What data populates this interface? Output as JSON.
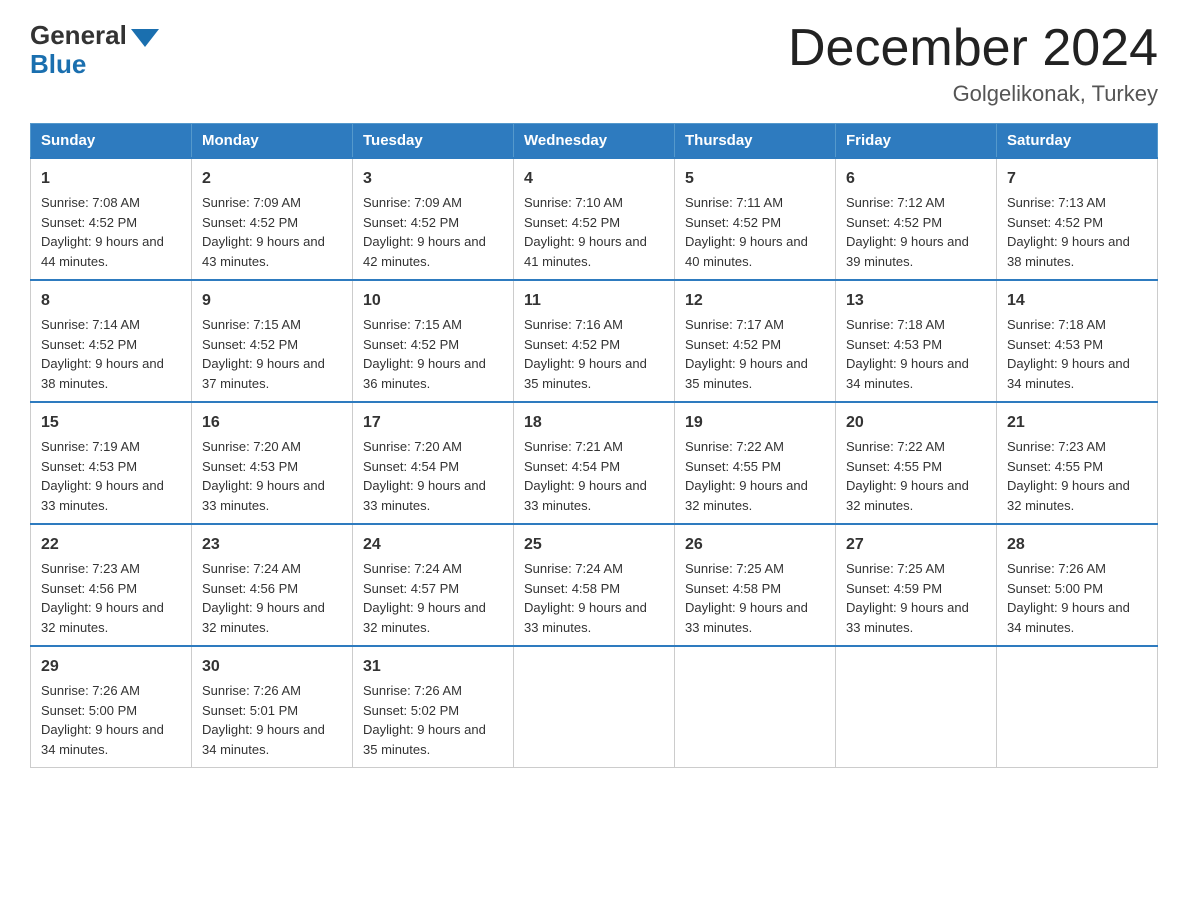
{
  "logo": {
    "general": "General",
    "blue": "Blue"
  },
  "title": "December 2024",
  "location": "Golgelikonak, Turkey",
  "weekdays": [
    "Sunday",
    "Monday",
    "Tuesday",
    "Wednesday",
    "Thursday",
    "Friday",
    "Saturday"
  ],
  "weeks": [
    [
      {
        "day": "1",
        "sunrise": "Sunrise: 7:08 AM",
        "sunset": "Sunset: 4:52 PM",
        "daylight": "Daylight: 9 hours and 44 minutes."
      },
      {
        "day": "2",
        "sunrise": "Sunrise: 7:09 AM",
        "sunset": "Sunset: 4:52 PM",
        "daylight": "Daylight: 9 hours and 43 minutes."
      },
      {
        "day": "3",
        "sunrise": "Sunrise: 7:09 AM",
        "sunset": "Sunset: 4:52 PM",
        "daylight": "Daylight: 9 hours and 42 minutes."
      },
      {
        "day": "4",
        "sunrise": "Sunrise: 7:10 AM",
        "sunset": "Sunset: 4:52 PM",
        "daylight": "Daylight: 9 hours and 41 minutes."
      },
      {
        "day": "5",
        "sunrise": "Sunrise: 7:11 AM",
        "sunset": "Sunset: 4:52 PM",
        "daylight": "Daylight: 9 hours and 40 minutes."
      },
      {
        "day": "6",
        "sunrise": "Sunrise: 7:12 AM",
        "sunset": "Sunset: 4:52 PM",
        "daylight": "Daylight: 9 hours and 39 minutes."
      },
      {
        "day": "7",
        "sunrise": "Sunrise: 7:13 AM",
        "sunset": "Sunset: 4:52 PM",
        "daylight": "Daylight: 9 hours and 38 minutes."
      }
    ],
    [
      {
        "day": "8",
        "sunrise": "Sunrise: 7:14 AM",
        "sunset": "Sunset: 4:52 PM",
        "daylight": "Daylight: 9 hours and 38 minutes."
      },
      {
        "day": "9",
        "sunrise": "Sunrise: 7:15 AM",
        "sunset": "Sunset: 4:52 PM",
        "daylight": "Daylight: 9 hours and 37 minutes."
      },
      {
        "day": "10",
        "sunrise": "Sunrise: 7:15 AM",
        "sunset": "Sunset: 4:52 PM",
        "daylight": "Daylight: 9 hours and 36 minutes."
      },
      {
        "day": "11",
        "sunrise": "Sunrise: 7:16 AM",
        "sunset": "Sunset: 4:52 PM",
        "daylight": "Daylight: 9 hours and 35 minutes."
      },
      {
        "day": "12",
        "sunrise": "Sunrise: 7:17 AM",
        "sunset": "Sunset: 4:52 PM",
        "daylight": "Daylight: 9 hours and 35 minutes."
      },
      {
        "day": "13",
        "sunrise": "Sunrise: 7:18 AM",
        "sunset": "Sunset: 4:53 PM",
        "daylight": "Daylight: 9 hours and 34 minutes."
      },
      {
        "day": "14",
        "sunrise": "Sunrise: 7:18 AM",
        "sunset": "Sunset: 4:53 PM",
        "daylight": "Daylight: 9 hours and 34 minutes."
      }
    ],
    [
      {
        "day": "15",
        "sunrise": "Sunrise: 7:19 AM",
        "sunset": "Sunset: 4:53 PM",
        "daylight": "Daylight: 9 hours and 33 minutes."
      },
      {
        "day": "16",
        "sunrise": "Sunrise: 7:20 AM",
        "sunset": "Sunset: 4:53 PM",
        "daylight": "Daylight: 9 hours and 33 minutes."
      },
      {
        "day": "17",
        "sunrise": "Sunrise: 7:20 AM",
        "sunset": "Sunset: 4:54 PM",
        "daylight": "Daylight: 9 hours and 33 minutes."
      },
      {
        "day": "18",
        "sunrise": "Sunrise: 7:21 AM",
        "sunset": "Sunset: 4:54 PM",
        "daylight": "Daylight: 9 hours and 33 minutes."
      },
      {
        "day": "19",
        "sunrise": "Sunrise: 7:22 AM",
        "sunset": "Sunset: 4:55 PM",
        "daylight": "Daylight: 9 hours and 32 minutes."
      },
      {
        "day": "20",
        "sunrise": "Sunrise: 7:22 AM",
        "sunset": "Sunset: 4:55 PM",
        "daylight": "Daylight: 9 hours and 32 minutes."
      },
      {
        "day": "21",
        "sunrise": "Sunrise: 7:23 AM",
        "sunset": "Sunset: 4:55 PM",
        "daylight": "Daylight: 9 hours and 32 minutes."
      }
    ],
    [
      {
        "day": "22",
        "sunrise": "Sunrise: 7:23 AM",
        "sunset": "Sunset: 4:56 PM",
        "daylight": "Daylight: 9 hours and 32 minutes."
      },
      {
        "day": "23",
        "sunrise": "Sunrise: 7:24 AM",
        "sunset": "Sunset: 4:56 PM",
        "daylight": "Daylight: 9 hours and 32 minutes."
      },
      {
        "day": "24",
        "sunrise": "Sunrise: 7:24 AM",
        "sunset": "Sunset: 4:57 PM",
        "daylight": "Daylight: 9 hours and 32 minutes."
      },
      {
        "day": "25",
        "sunrise": "Sunrise: 7:24 AM",
        "sunset": "Sunset: 4:58 PM",
        "daylight": "Daylight: 9 hours and 33 minutes."
      },
      {
        "day": "26",
        "sunrise": "Sunrise: 7:25 AM",
        "sunset": "Sunset: 4:58 PM",
        "daylight": "Daylight: 9 hours and 33 minutes."
      },
      {
        "day": "27",
        "sunrise": "Sunrise: 7:25 AM",
        "sunset": "Sunset: 4:59 PM",
        "daylight": "Daylight: 9 hours and 33 minutes."
      },
      {
        "day": "28",
        "sunrise": "Sunrise: 7:26 AM",
        "sunset": "Sunset: 5:00 PM",
        "daylight": "Daylight: 9 hours and 34 minutes."
      }
    ],
    [
      {
        "day": "29",
        "sunrise": "Sunrise: 7:26 AM",
        "sunset": "Sunset: 5:00 PM",
        "daylight": "Daylight: 9 hours and 34 minutes."
      },
      {
        "day": "30",
        "sunrise": "Sunrise: 7:26 AM",
        "sunset": "Sunset: 5:01 PM",
        "daylight": "Daylight: 9 hours and 34 minutes."
      },
      {
        "day": "31",
        "sunrise": "Sunrise: 7:26 AM",
        "sunset": "Sunset: 5:02 PM",
        "daylight": "Daylight: 9 hours and 35 minutes."
      },
      {
        "day": "",
        "sunrise": "",
        "sunset": "",
        "daylight": ""
      },
      {
        "day": "",
        "sunrise": "",
        "sunset": "",
        "daylight": ""
      },
      {
        "day": "",
        "sunrise": "",
        "sunset": "",
        "daylight": ""
      },
      {
        "day": "",
        "sunrise": "",
        "sunset": "",
        "daylight": ""
      }
    ]
  ]
}
